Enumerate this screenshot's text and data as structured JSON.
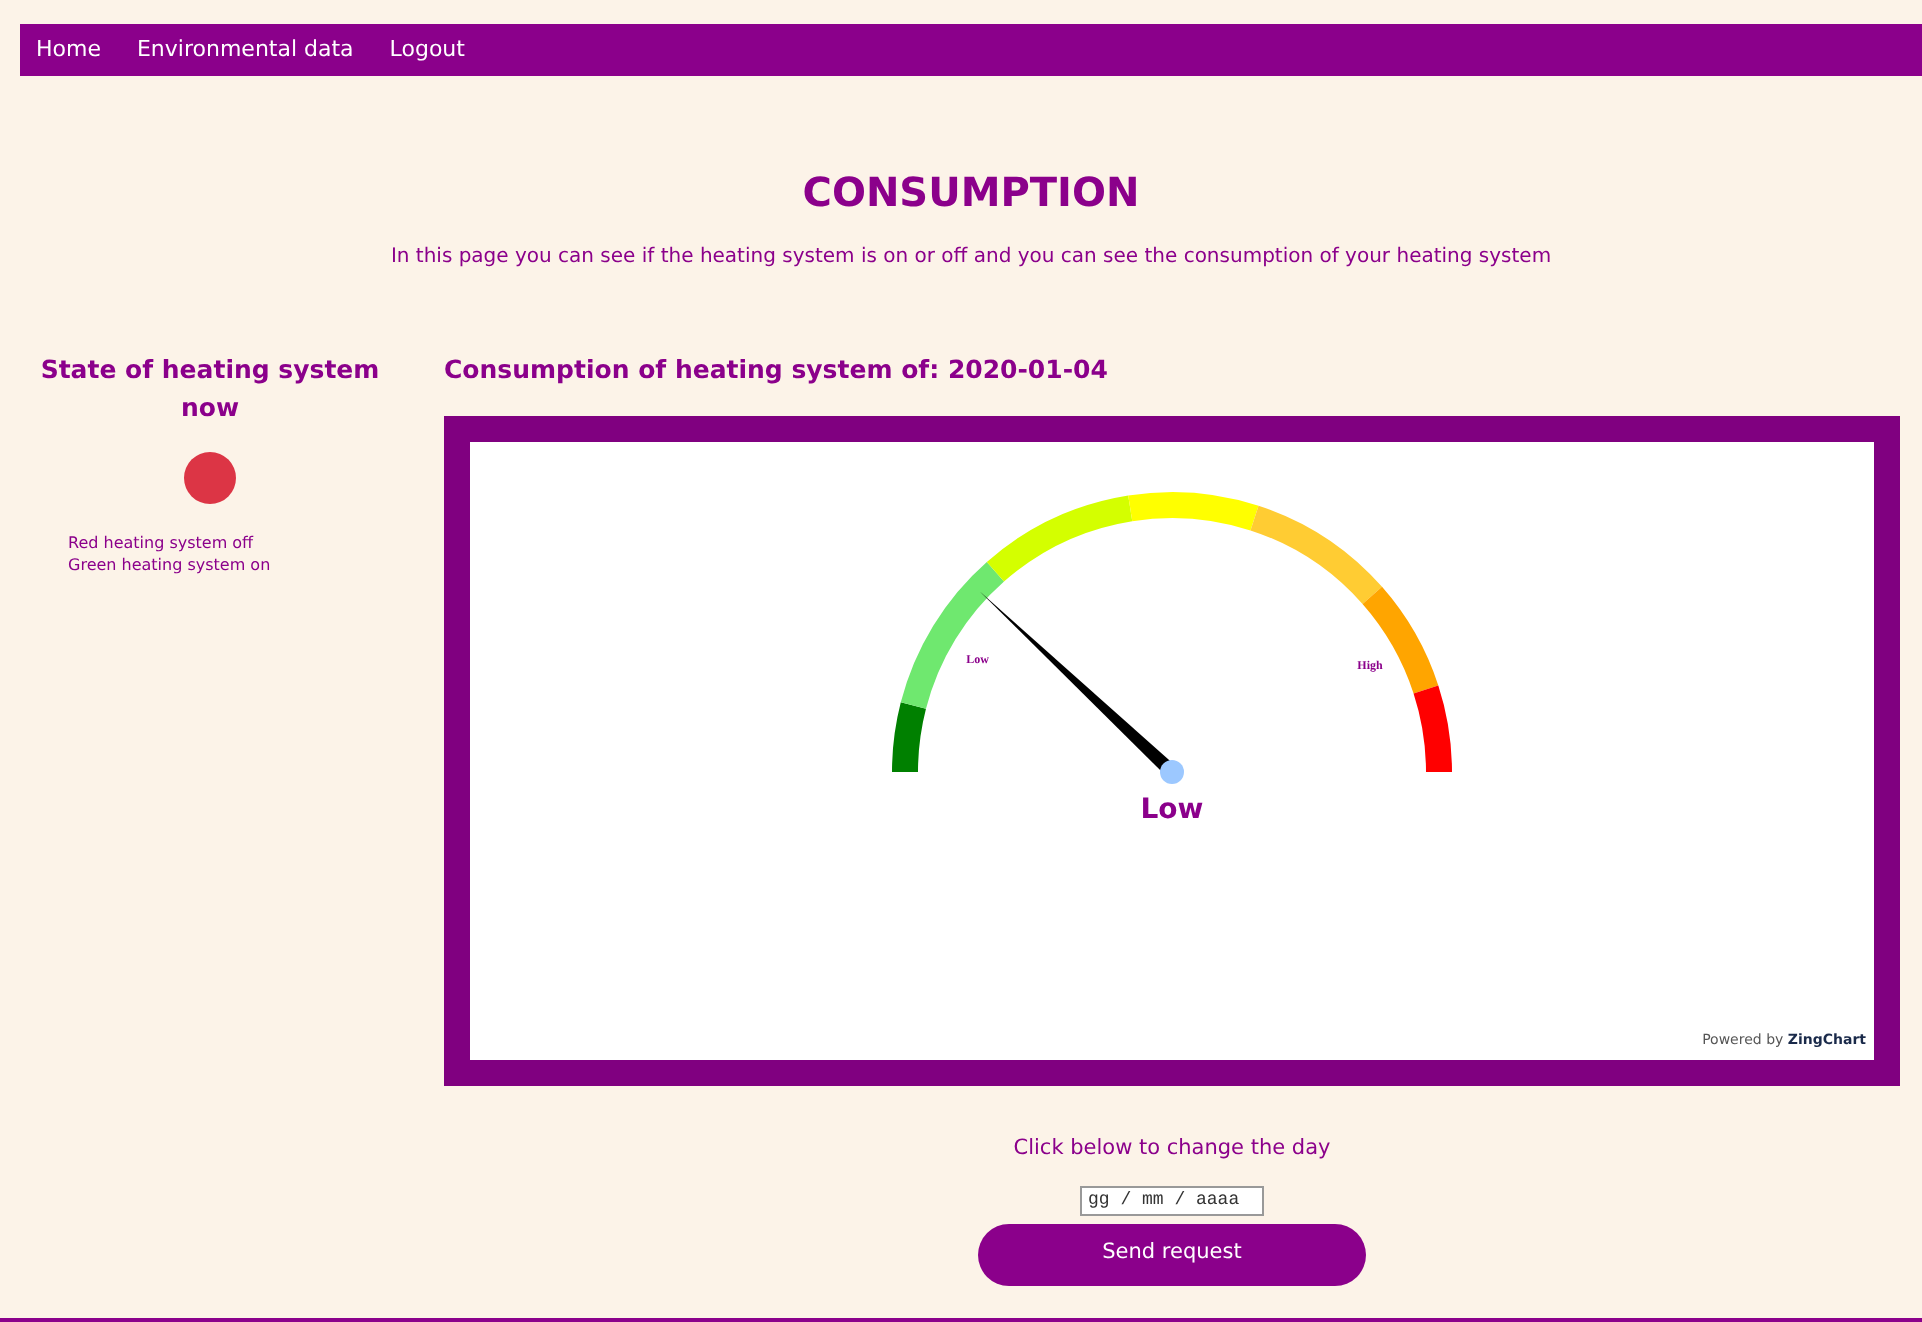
{
  "nav": [
    {
      "label": "Home"
    },
    {
      "label": "Environmental data"
    },
    {
      "label": "Logout"
    }
  ],
  "title": "CONSUMPTION",
  "subtitle": "In this page you can see if the heating system is on or off and you can see the consumption of your heating system",
  "state_panel": {
    "heading": "State of heating system now",
    "on": false,
    "legend": [
      "Red heating system off",
      "Green heating system on"
    ]
  },
  "consumption": {
    "heading": "Consumption of heating system of: 2020-01-04",
    "gauge": {
      "value_label": "Low",
      "scale_labels": [
        "Low",
        "High"
      ],
      "credit_prefix": "Powered by",
      "credit_brand": "ZingChart"
    }
  },
  "day_form": {
    "prompt": "Click below to change the day",
    "date_placeholder": "gg / mm / aaaa",
    "button": "Send request"
  }
}
